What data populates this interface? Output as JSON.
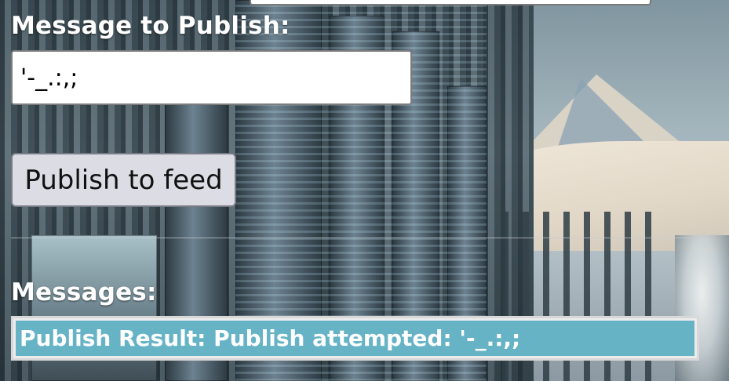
{
  "form": {
    "message_label": "Message to Publish:",
    "message_value": "'-_.:,;",
    "publish_button_label": "Publish to feed"
  },
  "messages": {
    "heading": "Messages:",
    "items": [
      {
        "text": "Publish Result: Publish attempted: '-_.:,;"
      }
    ]
  },
  "colors": {
    "message_item_background": "#66b3c6",
    "button_background": "#dcdce4",
    "label_text": "#ffffff"
  }
}
